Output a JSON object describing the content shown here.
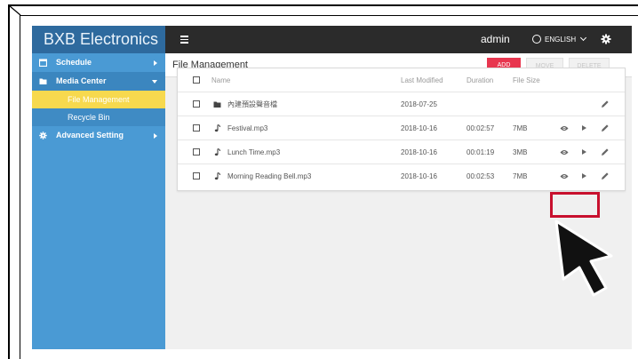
{
  "sidebar": {
    "brand": "BXB Electronics",
    "items": [
      {
        "label": "Schedule",
        "icon": "calendar-icon"
      },
      {
        "label": "Media Center",
        "icon": "folder-icon"
      },
      {
        "label": "File Management"
      },
      {
        "label": "Recycle Bin"
      },
      {
        "label": "Advanced Setting",
        "icon": "gear-icon"
      }
    ]
  },
  "topbar": {
    "user": "admin",
    "language": "ENGLISH"
  },
  "header": {
    "title": "File Management",
    "add_label": "ADD",
    "move_label": "MOVE",
    "delete_label": "DELETE"
  },
  "table": {
    "columns": [
      "Name",
      "Last Modified",
      "Duration",
      "File Size"
    ],
    "rows": [
      {
        "name": "內建預設聲音檔",
        "type": "folder-icon",
        "modified": "2018-07-25",
        "duration": "",
        "size": ""
      },
      {
        "name": "Festival.mp3",
        "type": "music-note-icon",
        "modified": "2018-10-16",
        "duration": "00:02:57",
        "size": "7MB"
      },
      {
        "name": "Lunch Time.mp3",
        "type": "music-note-icon",
        "modified": "2018-10-16",
        "duration": "00:01:19",
        "size": "3MB"
      },
      {
        "name": "Morning Reading Bell.mp3",
        "type": "music-note-icon",
        "modified": "2018-10-16",
        "duration": "00:02:53",
        "size": "7MB"
      }
    ]
  },
  "colors": {
    "sidebar": "#4a9ad4",
    "brand_bar": "#2e6a9e",
    "active_item": "#f7d94e",
    "topbar": "#2b2b2b",
    "add_button": "#e8364f",
    "highlight": "#c8102e"
  }
}
